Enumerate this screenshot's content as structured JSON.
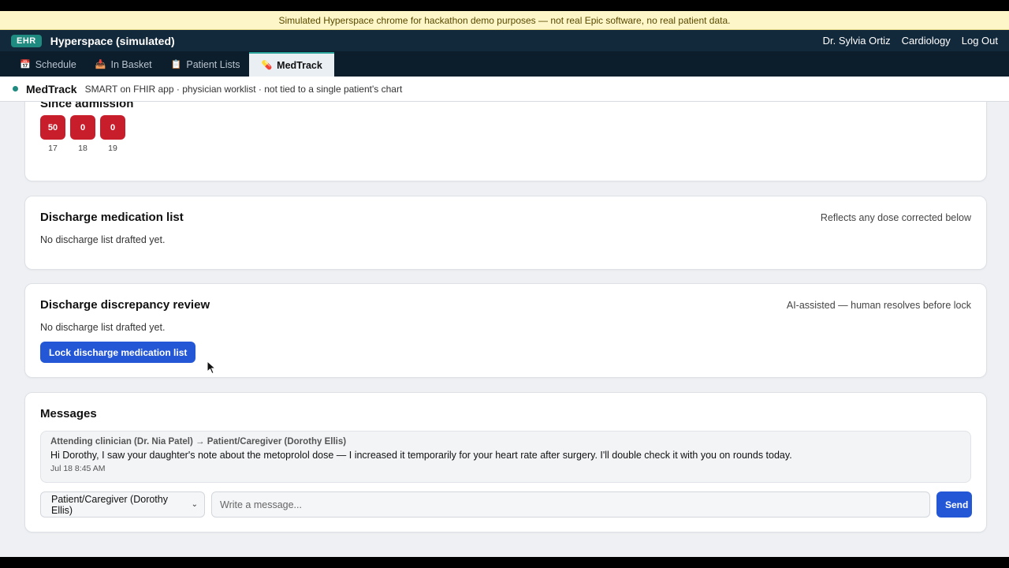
{
  "banner": {
    "text": "Simulated Hyperspace chrome for hackathon demo purposes — not real Epic software, no real patient data."
  },
  "topbar": {
    "badge": "EHR",
    "title": "Hyperspace (simulated)",
    "user": "Dr. Sylvia Ortiz",
    "department": "Cardiology",
    "logout": "Log Out"
  },
  "tabs": [
    {
      "label": "Schedule",
      "icon": "calendar-icon"
    },
    {
      "label": "In Basket",
      "icon": "inbox-icon"
    },
    {
      "label": "Patient Lists",
      "icon": "clipboard-icon"
    },
    {
      "label": "MedTrack",
      "icon": "pill-icon"
    }
  ],
  "appbar": {
    "name": "MedTrack",
    "subtitle": "SMART on FHIR app · physician worklist · not tied to a single patient's chart"
  },
  "since_admission": {
    "title": "Since admission",
    "pills": [
      {
        "value": "50",
        "day": "17"
      },
      {
        "value": "0",
        "day": "18"
      },
      {
        "value": "0",
        "day": "19"
      }
    ]
  },
  "discharge_list": {
    "title": "Discharge medication list",
    "note": "Reflects any dose corrected below",
    "empty": "No discharge list drafted yet."
  },
  "discrepancy": {
    "title": "Discharge discrepancy review",
    "note": "AI-assisted — human resolves before lock",
    "empty": "No discharge list drafted yet.",
    "lock_button": "Lock discharge medication list"
  },
  "messages": {
    "title": "Messages",
    "items": [
      {
        "header": "Attending clinician (Dr. Nia Patel) → Patient/Caregiver (Dorothy Ellis)",
        "body": "Hi Dorothy, I saw your daughter's note about the metoprolol dose — I increased it temporarily for your heart rate after surgery. I'll double check it with you on rounds today.",
        "time": "Jul 18 8:45 AM"
      }
    ],
    "recipient": "Patient/Caregiver (Dorothy Ellis)",
    "placeholder": "Write a message...",
    "send": "Send"
  },
  "colors": {
    "accent": "#1f8b80",
    "primary_button": "#2457d6",
    "alert_pill": "#c81e2c",
    "topbar": "#12283b"
  }
}
